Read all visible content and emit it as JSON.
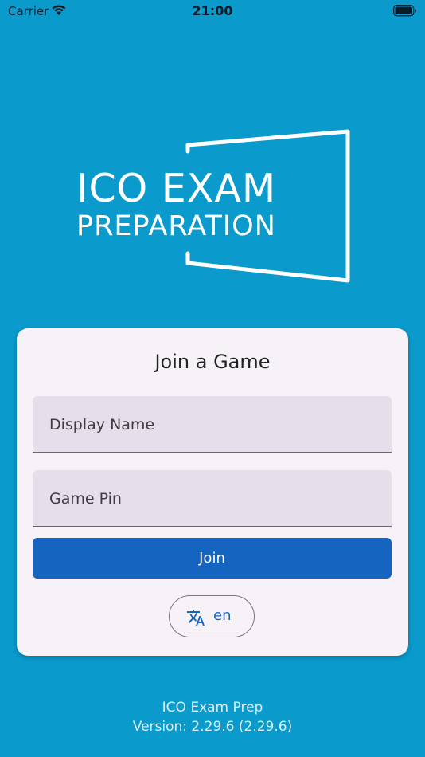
{
  "status_bar": {
    "carrier": "Carrier",
    "time": "21:00"
  },
  "logo": {
    "line1": "ICO EXAM",
    "line2": "PREPARATION"
  },
  "card": {
    "title": "Join a Game",
    "display_name_label": "Display Name",
    "game_pin_label": "Game Pin",
    "join_label": "Join",
    "language_label": "en"
  },
  "footer": {
    "app_name": "ICO Exam Prep",
    "version": "Version: 2.29.6 (2.29.6)"
  },
  "colors": {
    "background": "#0a9acb",
    "card": "#f6f2f7",
    "field": "#e6dfeb",
    "primary": "#1565c0"
  },
  "icons": [
    "wifi-icon",
    "battery-icon",
    "translate-icon"
  ]
}
